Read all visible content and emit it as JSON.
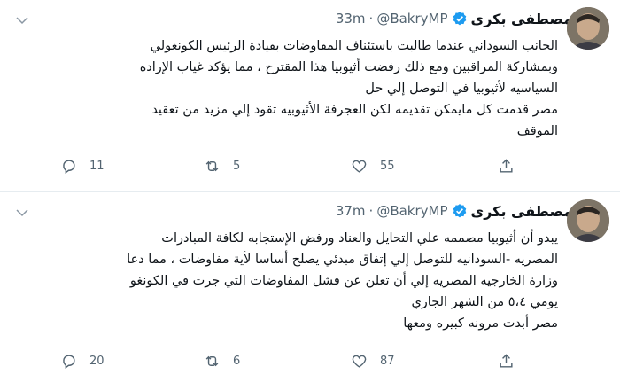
{
  "tweets": [
    {
      "display_name": "مصطفى بكرى",
      "handle": "@BakryMP",
      "time": "33m",
      "lines": [
        "الجانب السوداني عندما طالبت باستئناف المفاوضات بقيادة الرئيس الكونغولي",
        "وبمشاركة المراقبين ومع ذلك رفضت أثيوبيا هذا المقترح ، مما يؤكد غياب الإراده",
        "السياسيه لأثيوبيا في التوصل إلي حل",
        "مصر قدمت كل مايمكن تقديمه لكن العجرفة الأثيوبيه تقود إلي مزيد من تعقيد",
        "الموقف"
      ],
      "reply_count": "11",
      "retweet_count": "5",
      "like_count": "55"
    },
    {
      "display_name": "مصطفى بكرى",
      "handle": "@BakryMP",
      "time": "37m",
      "lines": [
        "يبدو أن أثيوبيا مصممه علي التحايل والعناد ورفض الإستجابه لكافة المبادرات",
        "المصريه -السودانيه للتوصل إلي إتفاق مبدئي يصلح أساسا لأية مفاوضات ، مما دعا",
        "وزارة الخارجيه المصريه إلي أن تعلن عن فشل المفاوضات التي جرت في الكونغو",
        "يومي ٥،٤ من الشهر الجاري",
        "مصر أبدت مرونه كبيره ومعها"
      ],
      "reply_count": "20",
      "retweet_count": "6",
      "like_count": "87"
    }
  ],
  "icons": {
    "reply": "reply-icon",
    "retweet": "retweet-icon",
    "like": "heart-icon",
    "share": "share-icon",
    "more": "chevron-down-icon",
    "verified": "verified-badge-icon"
  },
  "colors": {
    "verified": "#1d9bf0",
    "secondary_text": "#536471",
    "divider": "#e6ecf0"
  }
}
